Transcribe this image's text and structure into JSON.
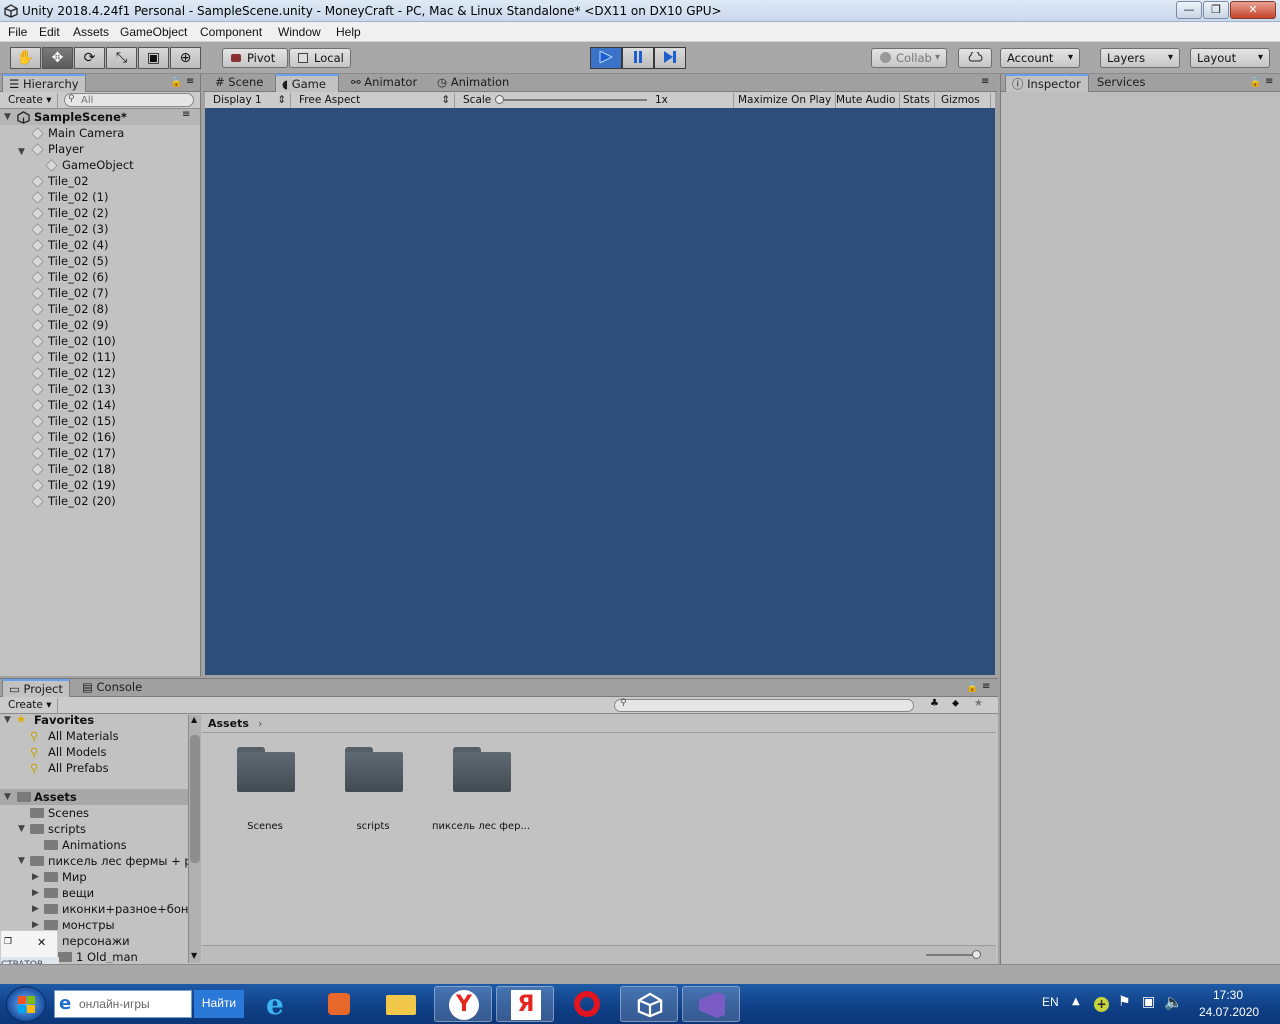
{
  "window": {
    "title": "Unity 2018.4.24f1 Personal - SampleScene.unity - MoneyCraft - PC, Mac & Linux Standalone* <DX11 on DX10 GPU>",
    "min": "—",
    "max": "❐",
    "close": "✕"
  },
  "menu": [
    "File",
    "Edit",
    "Assets",
    "GameObject",
    "Component",
    "Window",
    "Help"
  ],
  "toolbar": {
    "tools": [
      "✋",
      "✥",
      "⟳",
      "⤡",
      "▣",
      "⊕"
    ],
    "pivot": "Pivot",
    "local": "Local",
    "collab": "Collab",
    "account": "Account",
    "layers": "Layers",
    "layout": "Layout"
  },
  "hierarchy": {
    "tab": "Hierarchy",
    "create": "Create",
    "search_placeholder": "All",
    "scene": "SampleScene*",
    "items": [
      {
        "label": "Main Camera",
        "depth": 1
      },
      {
        "label": "Player",
        "depth": 1,
        "expanded": true
      },
      {
        "label": "GameObject",
        "depth": 2
      },
      {
        "label": "Tile_02",
        "depth": 1
      },
      {
        "label": "Tile_02 (1)",
        "depth": 1
      },
      {
        "label": "Tile_02 (2)",
        "depth": 1
      },
      {
        "label": "Tile_02 (3)",
        "depth": 1
      },
      {
        "label": "Tile_02 (4)",
        "depth": 1
      },
      {
        "label": "Tile_02 (5)",
        "depth": 1
      },
      {
        "label": "Tile_02 (6)",
        "depth": 1
      },
      {
        "label": "Tile_02 (7)",
        "depth": 1
      },
      {
        "label": "Tile_02 (8)",
        "depth": 1
      },
      {
        "label": "Tile_02 (9)",
        "depth": 1
      },
      {
        "label": "Tile_02 (10)",
        "depth": 1
      },
      {
        "label": "Tile_02 (11)",
        "depth": 1
      },
      {
        "label": "Tile_02 (12)",
        "depth": 1
      },
      {
        "label": "Tile_02 (13)",
        "depth": 1
      },
      {
        "label": "Tile_02 (14)",
        "depth": 1
      },
      {
        "label": "Tile_02 (15)",
        "depth": 1
      },
      {
        "label": "Tile_02 (16)",
        "depth": 1
      },
      {
        "label": "Tile_02 (17)",
        "depth": 1
      },
      {
        "label": "Tile_02 (18)",
        "depth": 1
      },
      {
        "label": "Tile_02 (19)",
        "depth": 1
      },
      {
        "label": "Tile_02 (20)",
        "depth": 1
      }
    ]
  },
  "center_tabs": [
    "Scene",
    "Game",
    "Animator",
    "Animation"
  ],
  "game": {
    "display": "Display 1",
    "aspect": "Free Aspect",
    "scale_label": "Scale",
    "scale_value": "1x",
    "maximize": "Maximize On Play",
    "mute": "Mute Audio",
    "stats": "Stats",
    "gizmos": "Gizmos",
    "background": "#2e4e79"
  },
  "right_tabs": [
    "Inspector",
    "Services"
  ],
  "project": {
    "tabs": [
      "Project",
      "Console"
    ],
    "create": "Create",
    "breadcrumb": "Assets",
    "favorites": {
      "label": "Favorites",
      "items": [
        "All Materials",
        "All Models",
        "All Prefabs"
      ]
    },
    "assets_label": "Assets",
    "tree": [
      {
        "label": "Scenes",
        "depth": 1
      },
      {
        "label": "scripts",
        "depth": 1,
        "expanded": true
      },
      {
        "label": "Animations",
        "depth": 2
      },
      {
        "label": "пиксель лес фермы + р",
        "depth": 1,
        "expanded": true
      },
      {
        "label": "Мир",
        "depth": 2,
        "collapsed": true
      },
      {
        "label": "вещи",
        "depth": 2,
        "collapsed": true
      },
      {
        "label": "иконки+разное+бону",
        "depth": 2,
        "collapsed": true
      },
      {
        "label": "монстры",
        "depth": 2,
        "collapsed": true
      },
      {
        "label": "персонажи",
        "depth": 2
      },
      {
        "label": "1 Old_man",
        "depth": 3
      }
    ],
    "folders": [
      "Scenes",
      "scripts",
      "пиксель лес фер..."
    ]
  },
  "popup": {
    "label": "СТРАТОР"
  },
  "taskbar": {
    "search_value": "онлайн-игры",
    "search_button": "Найти",
    "lang": "EN",
    "time": "17:30",
    "date": "24.07.2020"
  }
}
